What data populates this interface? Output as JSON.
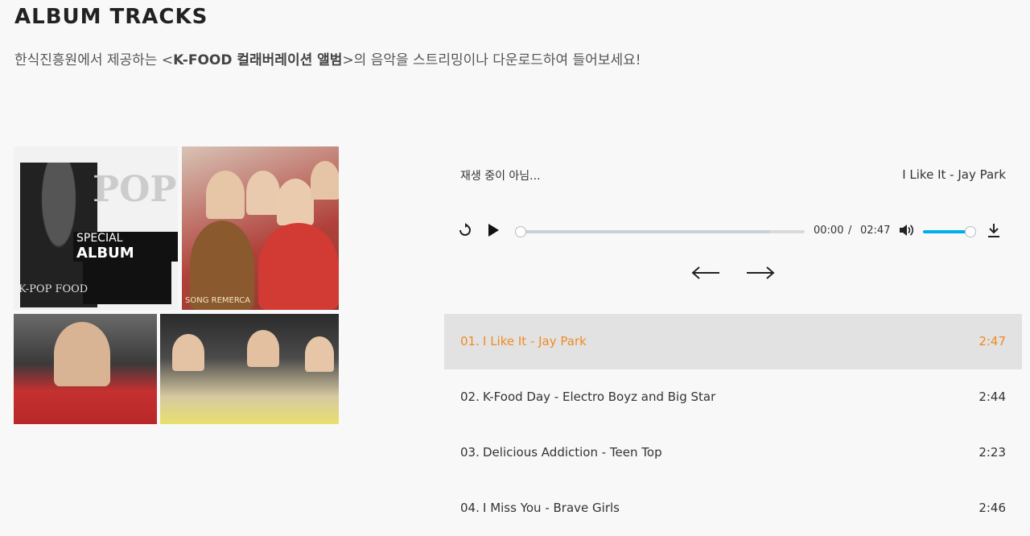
{
  "header": {
    "title": "ALBUM TRACKS",
    "subtitle_pre": "한식진흥원에서 제공하는 <",
    "subtitle_album": "K-FOOD 컬래버레이션 앨범",
    "subtitle_post": ">의 음악을 스트리밍이나 다운로드하여 들어보세요!"
  },
  "cover": {
    "pop_text": "POP",
    "special_text": "SPECIAL",
    "album_text": "ALBUM",
    "logo_text": "K-POP FOOD",
    "song_text": "SONG REMERCA"
  },
  "player": {
    "status": "재생 중이 아님...",
    "now_playing": "I Like It - Jay Park",
    "current_time": "00:00",
    "separator": "/",
    "total_time": "02:47",
    "progress": 0.0,
    "volume": 1.0,
    "accent_color": "#00adef",
    "icons": {
      "restart": "restart-icon",
      "play": "play-icon",
      "volume": "volume-icon",
      "download": "download-icon",
      "prev": "arrow-left-icon",
      "next": "arrow-right-icon"
    }
  },
  "playlist": {
    "active_color": "#f08a24",
    "tracks": [
      {
        "num": "01.",
        "name": "I Like It - Jay Park",
        "duration": "2:47",
        "active": true
      },
      {
        "num": "02.",
        "name": "K-Food Day - Electro Boyz and Big Star",
        "duration": "2:44",
        "active": false
      },
      {
        "num": "03.",
        "name": "Delicious Addiction - Teen Top",
        "duration": "2:23",
        "active": false
      },
      {
        "num": "04.",
        "name": "I Miss You - Brave Girls",
        "duration": "2:46",
        "active": false
      }
    ]
  }
}
